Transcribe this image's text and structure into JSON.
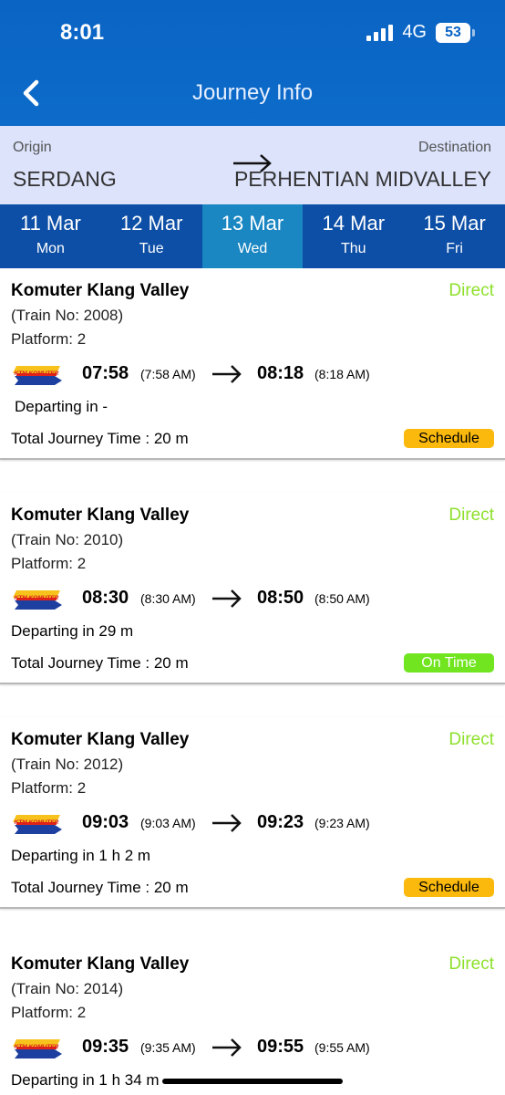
{
  "status_bar": {
    "time": "8:01",
    "network": "4G",
    "battery": "53"
  },
  "header": {
    "title": "Journey Info",
    "back_icon": "chevron-left-icon"
  },
  "route": {
    "origin_label": "Origin",
    "origin": "SERDANG",
    "destination_label": "Destination",
    "destination": "PERHENTIAN MIDVALLEY",
    "arrow_icon": "arrow-right-icon"
  },
  "dates": [
    {
      "day": "11 Mar",
      "weekday": "Mon",
      "selected": false
    },
    {
      "day": "12 Mar",
      "weekday": "Tue",
      "selected": false
    },
    {
      "day": "13 Mar",
      "weekday": "Wed",
      "selected": true
    },
    {
      "day": "14 Mar",
      "weekday": "Thu",
      "selected": false
    },
    {
      "day": "15 Mar",
      "weekday": "Fri",
      "selected": false
    }
  ],
  "trips": [
    {
      "name": "Komuter Klang Valley",
      "type": "Direct",
      "train": "(Train No: 2008)",
      "platform": "Platform: 2",
      "logo": "KTM KOMUTER",
      "dep": "07:58",
      "dep12": "(7:58 AM)",
      "arr": "08:18",
      "arr12": "(8:18 AM)",
      "departing": "Departing in  -",
      "total": "Total Journey Time : 20 m",
      "status": "Schedule"
    },
    {
      "name": "Komuter Klang Valley",
      "type": "Direct",
      "train": "(Train No: 2010)",
      "platform": "Platform: 2",
      "logo": "KTM KOMUTER",
      "dep": "08:30",
      "dep12": "(8:30 AM)",
      "arr": "08:50",
      "arr12": "(8:50 AM)",
      "departing": "Departing in 29 m",
      "total": "Total Journey Time : 20 m",
      "status": "On Time"
    },
    {
      "name": "Komuter Klang Valley",
      "type": "Direct",
      "train": "(Train No: 2012)",
      "platform": "Platform: 2",
      "logo": "KTM KOMUTER",
      "dep": "09:03",
      "dep12": "(9:03 AM)",
      "arr": "09:23",
      "arr12": "(9:23 AM)",
      "departing": "Departing in 1 h 2 m",
      "total": "Total Journey Time : 20 m",
      "status": "Schedule"
    },
    {
      "name": "Komuter Klang Valley",
      "type": "Direct",
      "train": "(Train No: 2014)",
      "platform": "Platform: 2",
      "logo": "KTM KOMUTER",
      "dep": "09:35",
      "dep12": "(9:35 AM)",
      "arr": "09:55",
      "arr12": "(9:55 AM)",
      "departing": "Departing in 1 h 34 m",
      "total": "",
      "status": ""
    }
  ],
  "colors": {
    "header": "#0a64c4",
    "route_bg": "#dce3fb",
    "date_bar": "#0d4fa6",
    "date_selected": "#1a86c2",
    "direct": "#8ee02c",
    "schedule": "#fbb90d",
    "on_time": "#71e51f"
  }
}
